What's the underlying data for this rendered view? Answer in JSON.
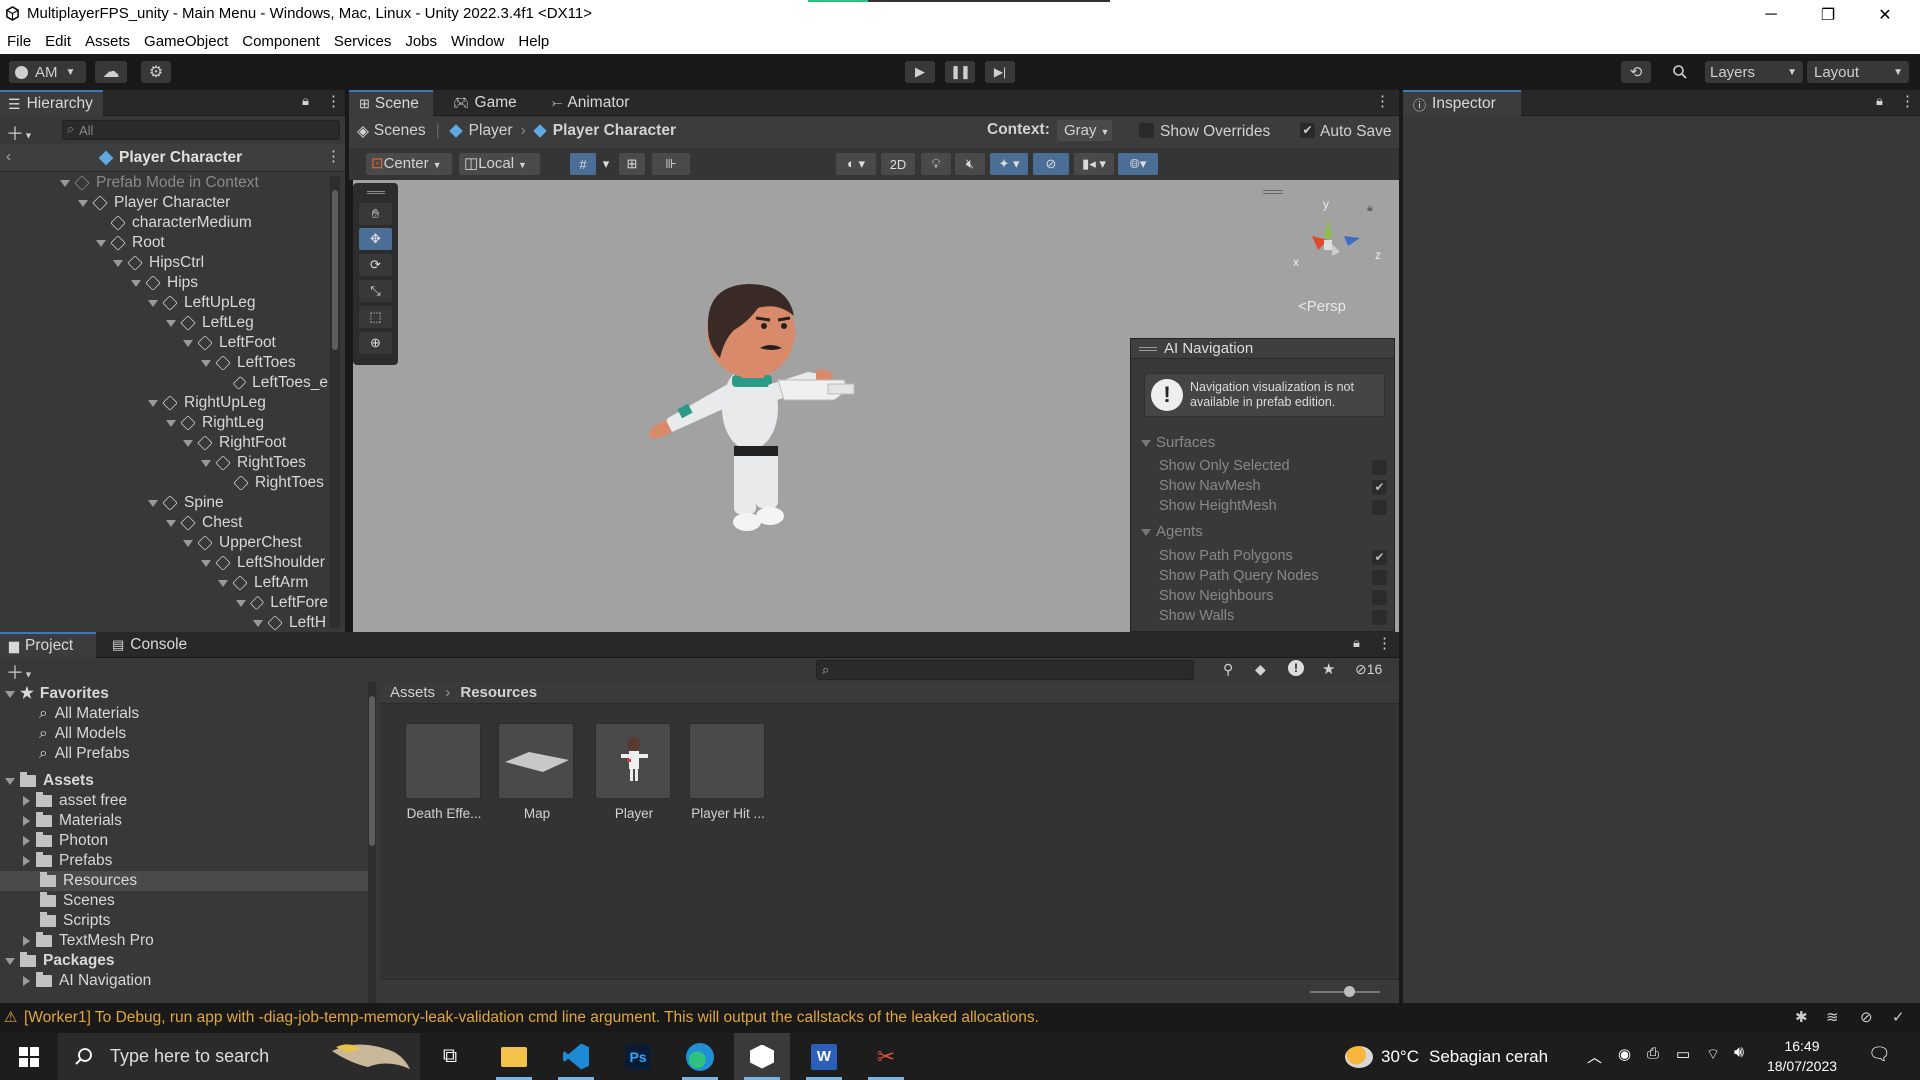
{
  "title_bar": {
    "title": "MultiplayerFPS_unity - Main Menu - Windows, Mac, Linux - Unity 2022.3.4f1 <DX11>",
    "minimize": "─",
    "maximize": "❐",
    "close": "✕"
  },
  "menu": [
    "File",
    "Edit",
    "Assets",
    "GameObject",
    "Component",
    "Services",
    "Jobs",
    "Window",
    "Help"
  ],
  "toolbar": {
    "account": "AM",
    "layers": "Layers",
    "layout": "Layout"
  },
  "hierarchy": {
    "tab": "Hierarchy",
    "search_placeholder": "All",
    "header": "Player Character",
    "items": [
      {
        "label": "Prefab Mode in Context",
        "depth": 0,
        "expanded": true,
        "muted": true
      },
      {
        "label": "Player Character",
        "depth": 1,
        "expanded": true
      },
      {
        "label": "characterMedium",
        "depth": 2,
        "leaf": true
      },
      {
        "label": "Root",
        "depth": 2,
        "expanded": true
      },
      {
        "label": "HipsCtrl",
        "depth": 3,
        "expanded": true
      },
      {
        "label": "Hips",
        "depth": 4,
        "expanded": true
      },
      {
        "label": "LeftUpLeg",
        "depth": 5,
        "expanded": true
      },
      {
        "label": "LeftLeg",
        "depth": 6,
        "expanded": true
      },
      {
        "label": "LeftFoot",
        "depth": 7,
        "expanded": true
      },
      {
        "label": "LeftToes",
        "depth": 8,
        "expanded": true
      },
      {
        "label": "LeftToes_e",
        "depth": 9,
        "leaf": true
      },
      {
        "label": "RightUpLeg",
        "depth": 5,
        "expanded": true
      },
      {
        "label": "RightLeg",
        "depth": 6,
        "expanded": true
      },
      {
        "label": "RightFoot",
        "depth": 7,
        "expanded": true
      },
      {
        "label": "RightToes",
        "depth": 8,
        "expanded": true
      },
      {
        "label": "RightToes",
        "depth": 9,
        "leaf": true
      },
      {
        "label": "Spine",
        "depth": 5,
        "expanded": true
      },
      {
        "label": "Chest",
        "depth": 6,
        "expanded": true
      },
      {
        "label": "UpperChest",
        "depth": 7,
        "expanded": true
      },
      {
        "label": "LeftShoulder",
        "depth": 8,
        "expanded": true
      },
      {
        "label": "LeftArm",
        "depth": 9,
        "expanded": true
      },
      {
        "label": "LeftFore",
        "depth": 10,
        "expanded": true
      },
      {
        "label": "LeftH",
        "depth": 11,
        "expanded": true
      }
    ]
  },
  "scene": {
    "tabs": [
      "Scene",
      "Game",
      "Animator"
    ],
    "breadcrumb": [
      "Scenes",
      "Player",
      "Player Character"
    ],
    "context_label": "Context:",
    "context_value": "Gray",
    "show_overrides": "Show Overrides",
    "auto_save": "Auto Save",
    "pivot": "Center",
    "space": "Local",
    "mode_2d": "2D",
    "persp": "Persp",
    "gizmo_axes": [
      "y",
      "x",
      "z"
    ]
  },
  "ai_navigation": {
    "title": "AI Navigation",
    "warning": "Navigation visualization is not available in prefab edition.",
    "surfaces_header": "Surfaces",
    "surfaces": [
      {
        "label": "Show Only Selected",
        "checked": false
      },
      {
        "label": "Show NavMesh",
        "checked": true
      },
      {
        "label": "Show HeightMesh",
        "checked": false
      }
    ],
    "agents_header": "Agents",
    "agents": [
      {
        "label": "Show Path Polygons",
        "checked": true
      },
      {
        "label": "Show Path Query Nodes",
        "checked": false
      },
      {
        "label": "Show Neighbours",
        "checked": false
      },
      {
        "label": "Show Walls",
        "checked": false
      }
    ]
  },
  "inspector": {
    "tab": "Inspector"
  },
  "project": {
    "tabs": [
      "Project",
      "Console"
    ],
    "hidden_count": "16",
    "breadcrumb": [
      "Assets",
      "Resources"
    ],
    "favorites_header": "Favorites",
    "favorites": [
      "All Materials",
      "All Models",
      "All Prefabs"
    ],
    "assets_header": "Assets",
    "folders": [
      {
        "label": "asset free",
        "has_children": true
      },
      {
        "label": "Materials",
        "has_children": true
      },
      {
        "label": "Photon",
        "has_children": true
      },
      {
        "label": "Prefabs",
        "has_children": true
      },
      {
        "label": "Resources",
        "has_children": false,
        "selected": true
      },
      {
        "label": "Scenes",
        "has_children": false
      },
      {
        "label": "Scripts",
        "has_children": false
      },
      {
        "label": "TextMesh Pro",
        "has_children": true
      }
    ],
    "packages_header": "Packages",
    "packages": [
      "AI Navigation"
    ],
    "assets": [
      "Death Effe...",
      "Map",
      "Player",
      "Player Hit ..."
    ]
  },
  "status": {
    "message": "[Worker1] To Debug, run app with -diag-job-temp-memory-leak-validation cmd line argument. This will output the callstacks of the leaked allocations."
  },
  "taskbar": {
    "search_placeholder": "Type here to search",
    "weather_temp": "30°C",
    "weather_desc": "Sebagian cerah",
    "time": "16:49",
    "date": "18/07/2023",
    "ps_label": "Ps"
  },
  "colors": {
    "accent": "#3a79bb",
    "warning": "#e0a640",
    "scene_bg": "#a2a2a2"
  }
}
